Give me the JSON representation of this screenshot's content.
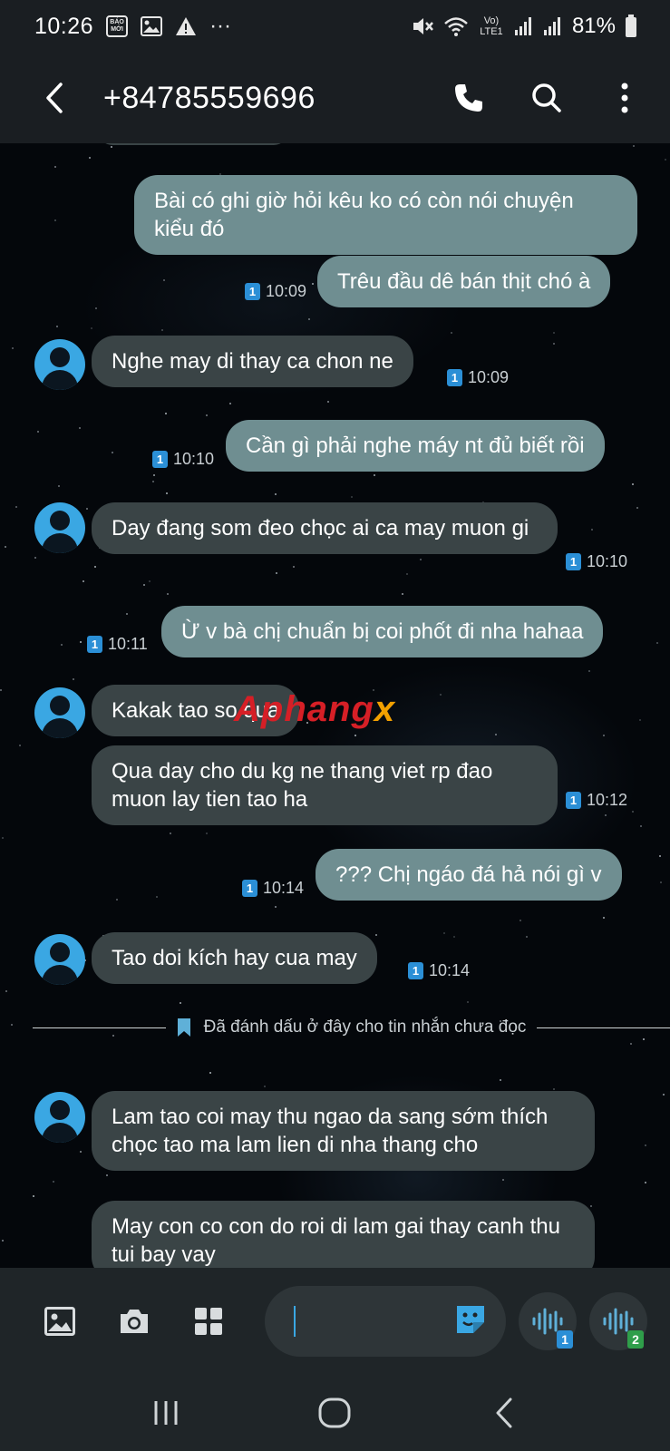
{
  "status_bar": {
    "time": "10:26",
    "baomoi_label": "BÁO MỚI",
    "overflow": "···",
    "network_label": "Vo) LTE1",
    "battery": "81%"
  },
  "header": {
    "title": "+84785559696"
  },
  "messages": [
    {
      "text": "Bài có ghi giờ hỏi kêu ko có còn nói chuyện kiểu đó",
      "direction": "outgoing"
    },
    {
      "text": "Trêu đầu dê bán thịt chó à",
      "direction": "outgoing",
      "time": "10:09",
      "sim": "1"
    },
    {
      "text": "Nghe may di thay ca chon ne",
      "direction": "incoming",
      "time": "10:09",
      "sim": "1"
    },
    {
      "text": "Cần gì phải nghe máy nt đủ biết rồi",
      "direction": "outgoing",
      "time": "10:10",
      "sim": "1"
    },
    {
      "text": "Day đang som đeo chọc ai ca may muon gi",
      "direction": "incoming",
      "time": "10:10",
      "sim": "1"
    },
    {
      "text": "Ừ v bà chị chuẩn bị coi phốt đi nha hahaa",
      "direction": "outgoing",
      "time": "10:11",
      "sim": "1"
    },
    {
      "text": "Kakak tao so qua",
      "direction": "incoming"
    },
    {
      "text": "Qua day cho du kg ne thang viet rp đao muon lay tien tao ha",
      "direction": "incoming",
      "time": "10:12",
      "sim": "1"
    },
    {
      "text": "??? Chị ngáo đá hả nói gì v",
      "direction": "outgoing",
      "time": "10:14",
      "sim": "1"
    },
    {
      "text": "Tao doi kích hay cua may",
      "direction": "incoming",
      "time": "10:14",
      "sim": "1"
    },
    {
      "text": "Lam tao coi may thu ngao da sang sớm thích chọc tao ma lam lien di nha thang cho",
      "direction": "incoming"
    },
    {
      "text": "May con co con do roi di lam gai thay canh thu tui bay vay",
      "direction": "incoming"
    }
  ],
  "unread_marker": "Đã đánh dấu ở đây cho tin nhắn chưa đọc",
  "watermark": {
    "main": "Aphang",
    "suffix": "x"
  },
  "input_bar": {
    "gallery_icon": "image-icon",
    "camera_icon": "camera-icon",
    "apps_icon": "grid-icon",
    "sticker_icon": "sticker-icon",
    "voice_sim1_badge": "1",
    "voice_sim2_badge": "2"
  },
  "colors": {
    "accent": "#3aa7e3",
    "outgoing_bubble": "#6f8e91",
    "incoming_bubble": "#3a4446",
    "sim2_badge": "#2f9e4a"
  }
}
